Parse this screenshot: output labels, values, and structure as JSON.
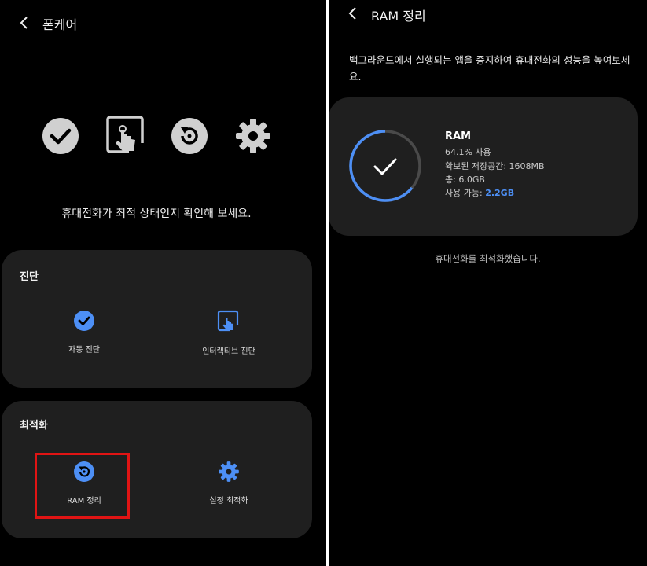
{
  "left": {
    "header": {
      "title": "폰케어"
    },
    "prompt": "휴대전화가 최적 상태인지 확인해 보세요.",
    "diagnosis": {
      "title": "진단",
      "items": [
        {
          "label": "자동 진단",
          "icon": "check-circle-icon"
        },
        {
          "label": "인터랙티브 진단",
          "icon": "touch-screen-icon"
        }
      ]
    },
    "optimization": {
      "title": "최적화",
      "items": [
        {
          "label": "RAM 정리",
          "icon": "ram-refresh-icon"
        },
        {
          "label": "설정 최적화",
          "icon": "gear-icon"
        }
      ]
    }
  },
  "right": {
    "header": {
      "title": "RAM 정리"
    },
    "description": "백그라운드에서 실행되는 앱을 중지하여 휴대전화의 성능을 높여보세요.",
    "ram": {
      "title": "RAM",
      "usage": "64.1% 사용",
      "freed": "확보된 저장공간: 1608MB",
      "total": "총: 6.0GB",
      "available_label": "사용 가능: ",
      "available_value": "2.2GB",
      "usage_fraction": 0.641
    },
    "status": "휴대전화를 최적화했습니다."
  },
  "colors": {
    "accent": "#4d8ff5",
    "card": "#1f1f1f",
    "highlight": "#e01414",
    "icon_gray": "#d0d0d0"
  }
}
